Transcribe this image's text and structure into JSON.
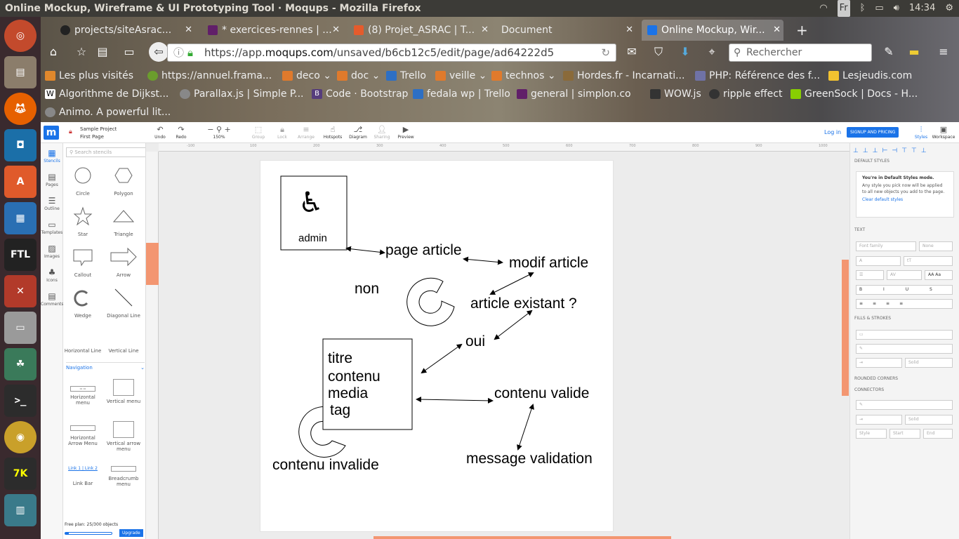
{
  "window_title": "Online Mockup, Wireframe & UI Prototyping Tool · Moqups - Mozilla Firefox",
  "system": {
    "keyboard": "Fr",
    "clock": "14:34"
  },
  "tabs": [
    {
      "label": "projects/siteAsrac...",
      "color": "#222"
    },
    {
      "label": "* exercices-rennes | ...",
      "color": "#611f69"
    },
    {
      "label": "(8) Projet_ASRAC | T...",
      "color": "#e55b2c"
    },
    {
      "label": "Document",
      "color": "#777"
    },
    {
      "label": "Online Mockup, Wir...",
      "color": "#1a73e8"
    }
  ],
  "url": {
    "prefix": "https://app.",
    "host": "moqups.com",
    "path": "/unsaved/b6cb12c5/edit/page/ad64222d5"
  },
  "search_placeholder": "Rechercher",
  "bookmarks_row1": [
    {
      "label": "Les plus visités",
      "color": "#e0882c"
    },
    {
      "label": "https://annuel.frama...",
      "color": "#6b9d2d"
    },
    {
      "label": "deco",
      "color": "#e07a2c"
    },
    {
      "label": "doc",
      "color": "#e07a2c"
    },
    {
      "label": "Trello",
      "color": "#2d6fc4"
    },
    {
      "label": "veille",
      "color": "#e07a2c"
    },
    {
      "label": "technos",
      "color": "#e07a2c"
    },
    {
      "label": "Hordes.fr - Incarnati...",
      "color": "#8a6a3a"
    },
    {
      "label": "PHP: Référence des f...",
      "color": "#6f72a6"
    },
    {
      "label": "Lesjeudis.com",
      "color": "#f2c230"
    }
  ],
  "bookmarks_row2": [
    {
      "label": "Algorithme de Dijkst...",
      "color": "#fff"
    },
    {
      "label": "Parallax.js | Simple P...",
      "color": "#888"
    },
    {
      "label": "Code · Bootstrap",
      "color": "#563d7c"
    },
    {
      "label": "fedala wp | Trello",
      "color": "#2d6fc4"
    },
    {
      "label": "general | simplon.co",
      "color": "#611f69"
    },
    {
      "label": "WOW.js",
      "color": "#333"
    },
    {
      "label": "ripple effect",
      "color": "#333"
    },
    {
      "label": "GreenSock | Docs - H...",
      "color": "#88ce02"
    }
  ],
  "bookmarks_row3": [
    {
      "label": "Animo. A powerful lit...",
      "color": "#888"
    }
  ],
  "app": {
    "project": "Sample Project",
    "page": "First Page",
    "toolbar": [
      {
        "label": "Undo",
        "icon": "↶"
      },
      {
        "label": "Redo",
        "icon": "↷"
      },
      {
        "label": "150%",
        "icon": "− ⚲ +"
      },
      {
        "label": "Group",
        "icon": "⬚"
      },
      {
        "label": "Lock",
        "icon": "🔒︎"
      },
      {
        "label": "Arrange",
        "icon": "≡"
      },
      {
        "label": "Hotspots",
        "icon": "☝"
      },
      {
        "label": "Diagram",
        "icon": "⎇"
      },
      {
        "label": "Sharing",
        "icon": "👤︎"
      },
      {
        "label": "Preview",
        "icon": "▶"
      }
    ],
    "login": "Log in",
    "signup": "SIGNUP AND PRICING",
    "right_tabs": [
      "Styles",
      "Workspace"
    ],
    "rail": [
      "Stencils",
      "Pages",
      "Outline",
      "Templates",
      "Images",
      "Icons",
      "Comments"
    ],
    "search_stencils": "Search stencils",
    "stencils": [
      "Circle",
      "Polygon",
      "Star",
      "Triangle",
      "Callout",
      "Arrow",
      "Wedge",
      "Diagonal Line",
      "Horizontal Line",
      "Vertical Line"
    ],
    "nav_section": "Navigation",
    "nav_stencils": [
      "Horizontal menu",
      "Vertical menu",
      "Horizontal Arrow Menu",
      "Vertical arrow menu",
      "Link Bar",
      "Breadcrumb menu"
    ],
    "plan": "Free plan: 25/300 objects",
    "plan_progress": 0.083,
    "upgrade": "Upgrade",
    "ruler_ticks": [
      "-100",
      "100",
      "200",
      "300",
      "400",
      "500",
      "600",
      "700",
      "800",
      "900",
      "1000"
    ],
    "styles": {
      "default_styles": "DEFAULT STYLES",
      "mode_title": "You're in Default Styles mode.",
      "mode_text": "Any style you pick now will be applied to all new objects you add to the page.",
      "clear": "Clear default styles",
      "text": "TEXT",
      "font_family": "Font family",
      "font_weight": "None",
      "fills": "FILLS & STROKES",
      "solid": "Solid",
      "rounded": "ROUNDED CORNERS",
      "connectors": "CONNECTORS",
      "style": "Style",
      "start": "Start",
      "end": "End"
    }
  },
  "diagram": {
    "admin": "admin",
    "page_article": "page article",
    "modif_article": "modif article",
    "non": "non",
    "article_existant": "article existant ?",
    "oui": "oui",
    "titre": "titre",
    "contenu": "contenu",
    "media": "media",
    "tag": "tag",
    "contenu_valide": "contenu valide",
    "contenu_invalide": "contenu invalide",
    "message_validation": "message validation"
  }
}
